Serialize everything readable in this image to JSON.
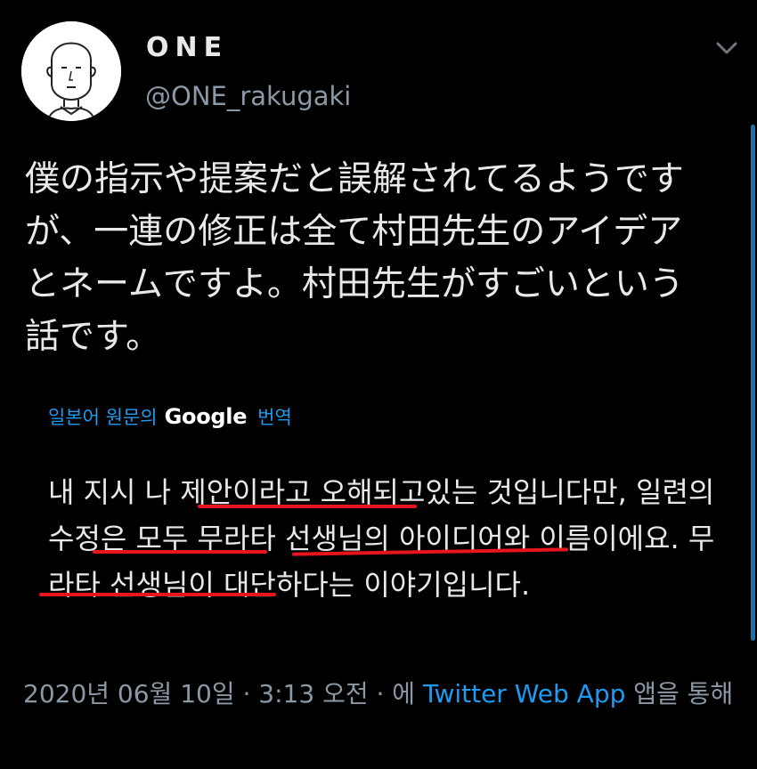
{
  "user": {
    "display_name": "ONE",
    "handle": "@ONE_rakugaki",
    "avatar_icon": "cartoon-face-avatar"
  },
  "more_icon": "chevron-down-icon",
  "tweet": {
    "text": "僕の指示や提案だと誤解されてるようですが、一連の修正は全て村田先生のアイデアとネームですよ。村田先生がすごいという話です。"
  },
  "translation": {
    "label": "일본어 원문의",
    "provider": "Google",
    "action": "번역",
    "text": "내 지시 나 제안이라고 오해되고있는 것입니다만, 일련의 수정은 모두 무라타 선생님의 아이디어와 이름이에요. 무라타 선생님이 대단하다는 이야기입니다."
  },
  "meta": {
    "timestamp": "2020년 06월 10일 · 3:13 오전 · 에",
    "source": "Twitter Web App",
    "suffix": "앱을 통해"
  },
  "colors": {
    "background": "#000000",
    "text": "#e7e9ea",
    "secondary": "#8b98a5",
    "link": "#1d9bf0",
    "annotation_underline": "#e8141e"
  }
}
